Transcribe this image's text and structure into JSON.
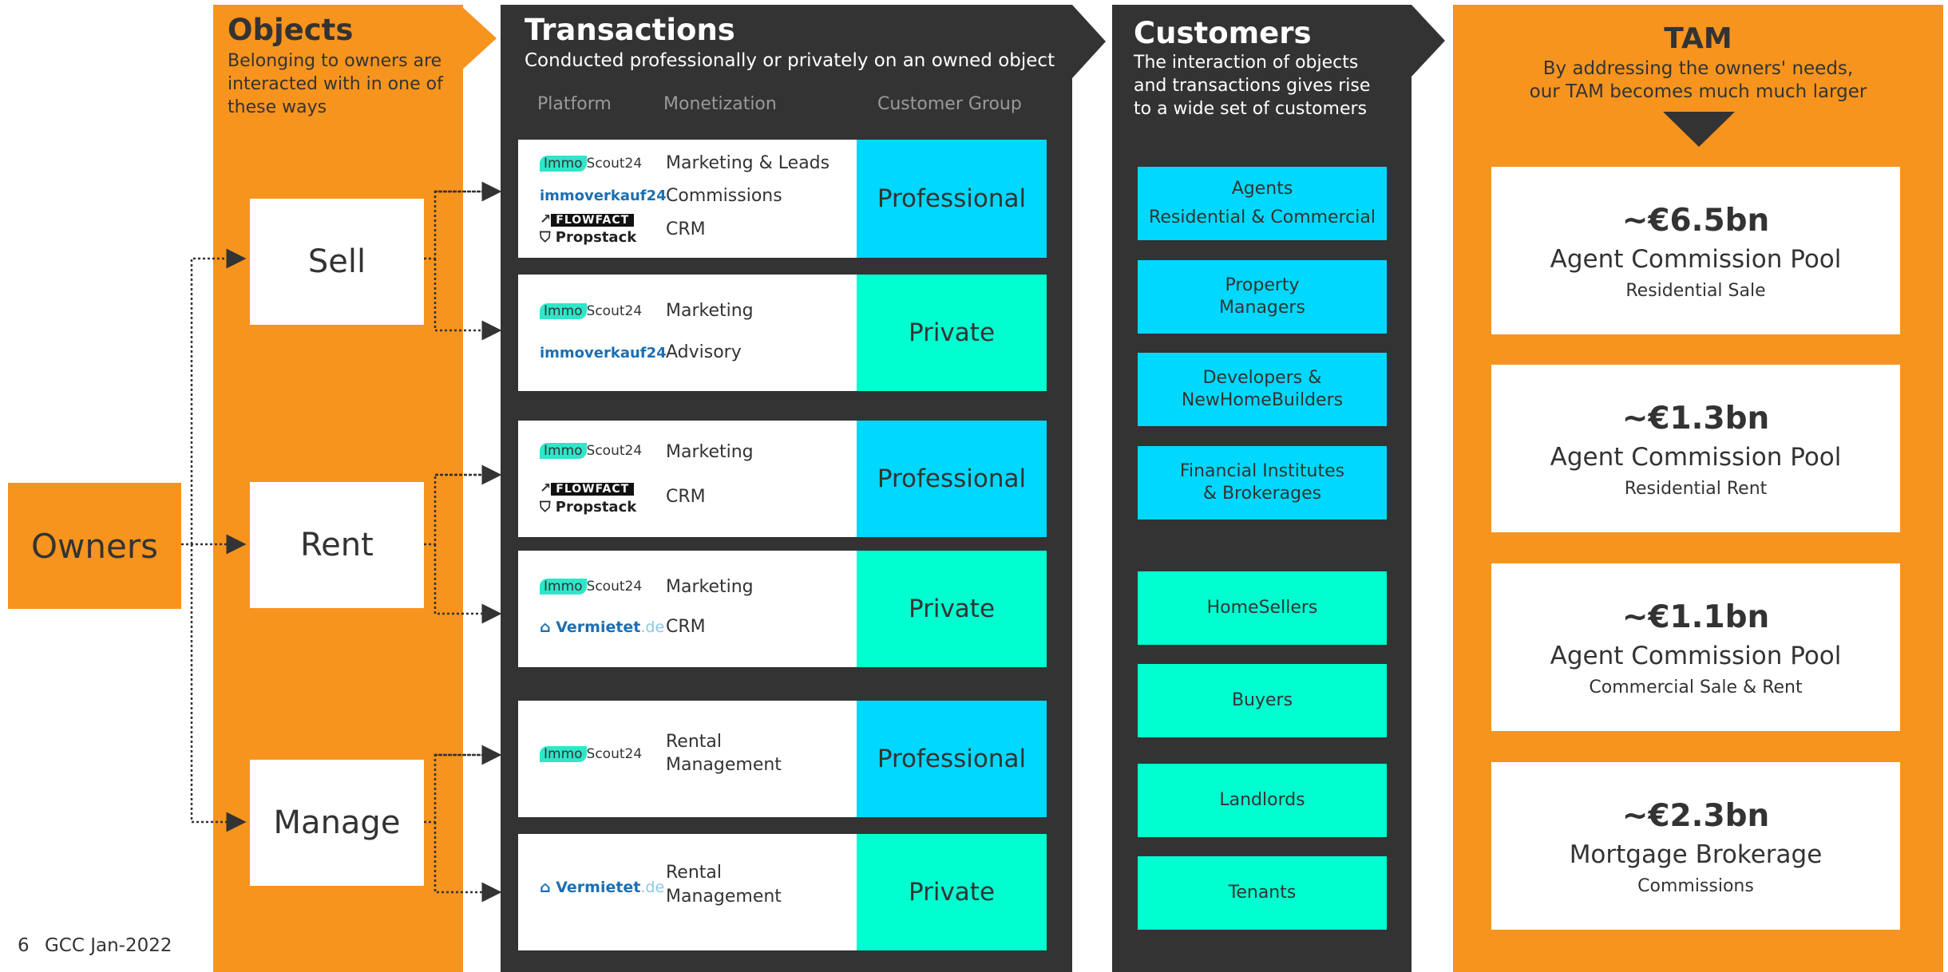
{
  "owners": {
    "label": "Owners"
  },
  "objects": {
    "title": "Objects",
    "subtitle": "Belonging to owners are interacted with in one of these ways",
    "items": [
      "Sell",
      "Rent",
      "Manage"
    ]
  },
  "transactions": {
    "title": "Transactions",
    "subtitle": "Conducted professionally or privately on an owned object",
    "column_headers": {
      "platform": "Platform",
      "monetization": "Monetization",
      "group": "Customer Group"
    },
    "logos": {
      "immo_badge": "Immo",
      "immo_text": "Scout24",
      "immoverkauf": "immoverkauf24",
      "flowfact": "FLOWFACT",
      "propstack": "Propstack",
      "vermietet": "Vermietet",
      "vermietet_tld": ".de"
    },
    "rows": [
      {
        "monetization": [
          "Marketing & Leads",
          "Commissions",
          "CRM"
        ],
        "group": "Professional"
      },
      {
        "monetization": [
          "Marketing",
          "Advisory"
        ],
        "group": "Private"
      },
      {
        "monetization": [
          "Marketing",
          "CRM"
        ],
        "group": "Professional"
      },
      {
        "monetization": [
          "Marketing",
          "CRM"
        ],
        "group": "Private"
      },
      {
        "monetization": [
          "Rental",
          "Management"
        ],
        "group": "Professional"
      },
      {
        "monetization": [
          "Rental",
          "Management"
        ],
        "group": "Private"
      }
    ]
  },
  "customers": {
    "title": "Customers",
    "subtitle": "The interaction of objects and transactions gives rise to a wide set of customers",
    "professional": [
      [
        "Agents",
        "Residential & Commercial"
      ],
      [
        "Property",
        "Managers"
      ],
      [
        "Developers &",
        "NewHomeBuilders"
      ],
      [
        "Financial Institutes",
        "& Brokerages"
      ]
    ],
    "private": [
      "HomeSellers",
      "Buyers",
      "Landlords",
      "Tenants"
    ]
  },
  "tam": {
    "title": "TAM",
    "subtitle": [
      "By addressing the owners' needs,",
      "our TAM becomes much much larger"
    ],
    "items": [
      {
        "value": "~€6.5bn",
        "label": "Agent Commission Pool",
        "sub": "Residential Sale"
      },
      {
        "value": "~€1.3bn",
        "label": "Agent Commission Pool",
        "sub": "Residential Rent"
      },
      {
        "value": "~€1.1bn",
        "label": "Agent Commission Pool",
        "sub": "Commercial Sale & Rent"
      },
      {
        "value": "~€2.3bn",
        "label": "Mortgage Brokerage",
        "sub": "Commissions"
      }
    ]
  },
  "footer": {
    "page": "6",
    "text": "GCC Jan-2022"
  },
  "colors": {
    "orange": "#f7941d",
    "dark": "#333333",
    "professional": "#00d8ff",
    "private": "#00ffd0",
    "white": "#ffffff"
  }
}
